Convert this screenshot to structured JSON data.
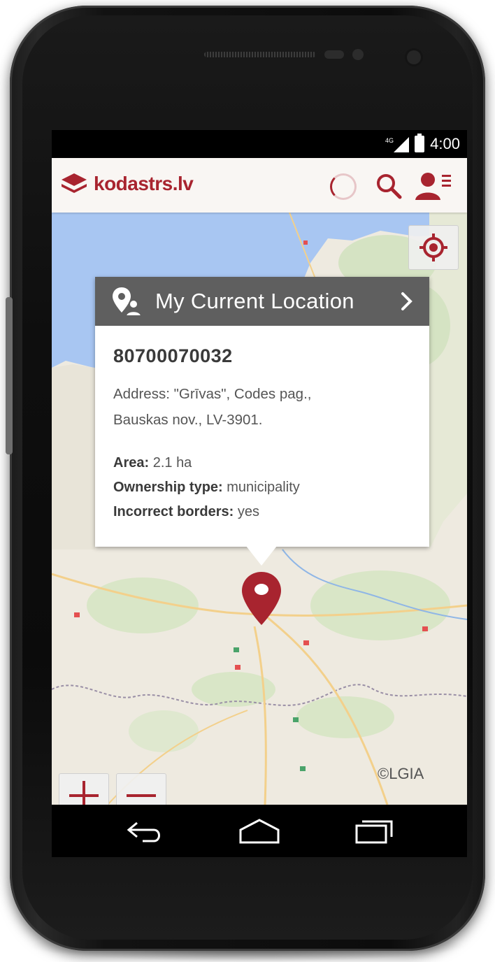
{
  "status_bar": {
    "network": "4G",
    "time": "4:00"
  },
  "app_bar": {
    "logo_text": "kodastrs.lv"
  },
  "popup": {
    "title": "My Current Location",
    "parcel_id": "80700070032",
    "address_line1": "Address: \"Grīvas\", Codes pag.,",
    "address_line2": "Bauskas nov., LV-3901.",
    "area_label": "Area:",
    "area_value": "2.1 ha",
    "ownership_label": "Ownership type:",
    "ownership_value": "municipality",
    "borders_label": "Incorrect borders:",
    "borders_value": "yes"
  },
  "map": {
    "attribution": "©LGIA"
  },
  "colors": {
    "brand": "#a8242f",
    "popup_header": "#5f5f5f"
  },
  "icons": [
    "layers-icon",
    "loading-spinner-icon",
    "search-icon",
    "user-menu-icon",
    "locate-me-icon",
    "pin-person-icon",
    "chevron-right-icon",
    "map-marker-icon",
    "zoom-in-icon",
    "zoom-out-icon",
    "back-icon",
    "home-icon",
    "recent-apps-icon"
  ]
}
